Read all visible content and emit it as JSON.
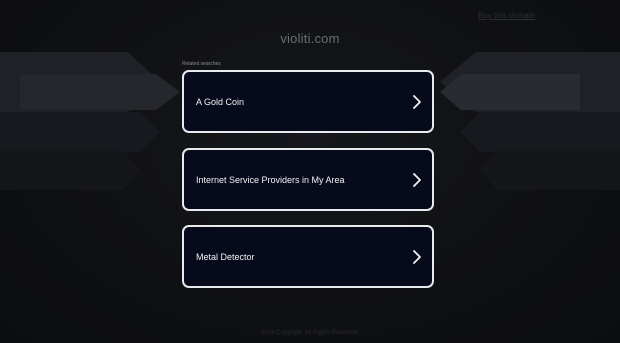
{
  "header": {
    "buy_link": "Buy this domain",
    "domain": "violiti.com"
  },
  "related": {
    "label": "Related searches",
    "items": [
      {
        "label": "A Gold Coin"
      },
      {
        "label": "Internet Service Providers in My Area"
      },
      {
        "label": "Metal Detector"
      }
    ]
  },
  "footer": {
    "text": "2024 Copyright. All Rights Reserved."
  },
  "colors": {
    "background": "#101114",
    "card_bg": "#060a1a",
    "card_border": "#e9eaee"
  },
  "icons": {
    "result_arrow": "chevron-right-icon"
  }
}
